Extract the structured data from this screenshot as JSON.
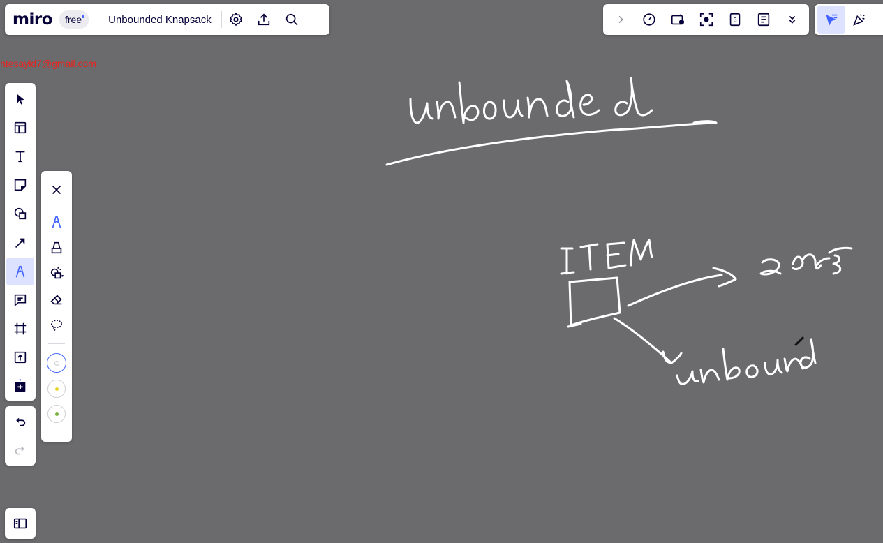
{
  "app": {
    "logo": "miro",
    "plan_badge": "free"
  },
  "board": {
    "title": "Unbounded Knapsack"
  },
  "user": {
    "email": "ntesayid7@gmail.com"
  },
  "colors": {
    "accent": "#4262ff",
    "email": "#e8231f",
    "canvas": "#6b6b6e",
    "swatch_white": "#ffffff",
    "swatch_yellow": "#e5d429",
    "swatch_green": "#7bb13c"
  },
  "toolbar_top": {
    "icons": [
      "settings-icon",
      "upload-icon",
      "search-icon"
    ]
  },
  "toolbar_right": {
    "icons": [
      "chevron-right-icon",
      "timer-icon",
      "screen-share-icon",
      "focus-icon",
      "counter-icon",
      "notes-icon",
      "more-chevron-icon"
    ],
    "counter_value": "3"
  },
  "collab": {
    "icons": [
      "presentation-cursor-icon",
      "celebrate-icon"
    ]
  },
  "left_toolbar": {
    "tools": [
      "select-tool",
      "templates-tool",
      "text-tool",
      "sticky-note-tool",
      "shapes-tool",
      "connector-tool",
      "pen-tool",
      "comment-tool",
      "frame-tool",
      "upload-tool",
      "add-apps-tool"
    ],
    "active": "pen-tool"
  },
  "pen_panel": {
    "tools": [
      "close",
      "pen",
      "highlighter",
      "shape-recognition",
      "eraser",
      "lasso"
    ],
    "swatches": [
      "white",
      "yellow",
      "green"
    ]
  },
  "drawing": {
    "words": [
      "unbounded",
      "ITEM",
      "∞ qty",
      "unbound"
    ]
  }
}
